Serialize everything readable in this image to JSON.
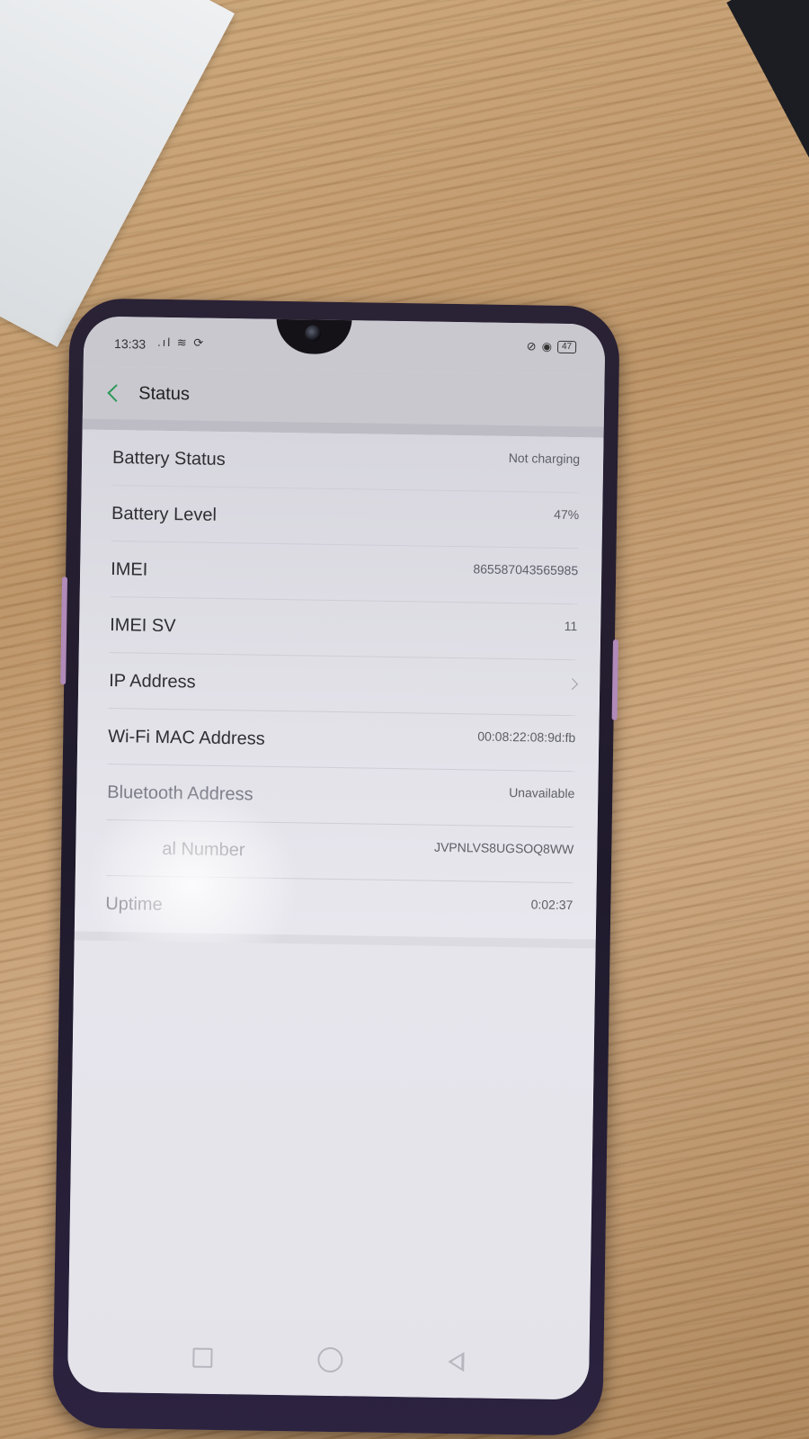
{
  "statusbar": {
    "time": "13:33",
    "left_icons": ".ıl ≋ ⟳",
    "battery": "47"
  },
  "header": {
    "title": "Status"
  },
  "rows": [
    {
      "label": "Battery Status",
      "value": "Not charging"
    },
    {
      "label": "Battery Level",
      "value": "47%"
    },
    {
      "label": "IMEI",
      "value": "865587043565985"
    },
    {
      "label": "IMEI SV",
      "value": "11"
    },
    {
      "label": "IP Address",
      "value": ""
    },
    {
      "label": "Wi-Fi MAC Address",
      "value": "00:08:22:08:9d:fb"
    },
    {
      "label": "Bluetooth Address",
      "value": "Unavailable"
    },
    {
      "label": "al Number",
      "value": "JVPNLVS8UGSOQ8WW"
    },
    {
      "label": "Uptime",
      "value": "0:02:37"
    }
  ],
  "icons": {
    "back": "chevron-left-icon",
    "ip_chevron": "chevron-right-icon",
    "nav_recent": "square-icon",
    "nav_home": "circle-icon",
    "nav_back": "triangle-icon"
  },
  "colors": {
    "accent": "#2f9a5a",
    "screen_bg": "#e4e3ea",
    "phone_body": "#2a2235"
  }
}
